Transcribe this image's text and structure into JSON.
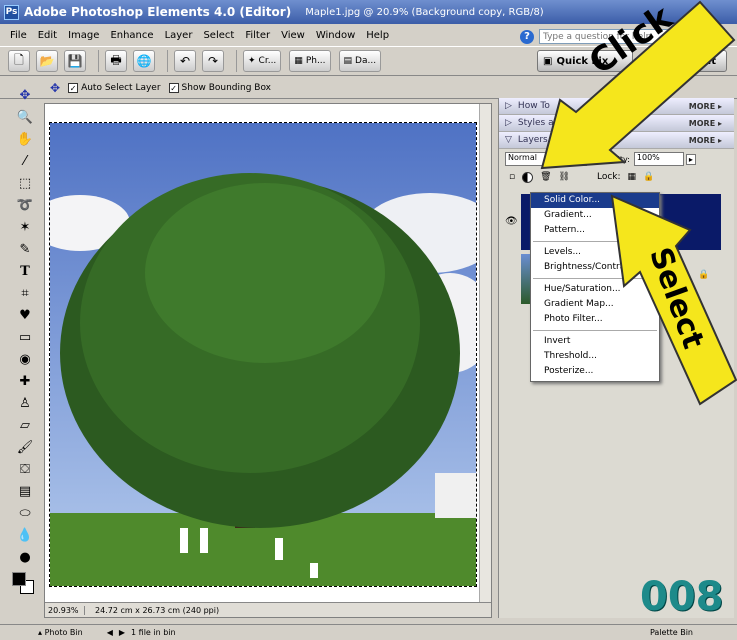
{
  "window": {
    "title": "Adobe Photoshop Elements 4.0 (Editor)",
    "document": "Maple1.jpg @ 20.9% (Background copy, RGB/8)"
  },
  "menu": [
    "File",
    "Edit",
    "Image",
    "Enhance",
    "Layer",
    "Select",
    "Filter",
    "View",
    "Window",
    "Help"
  ],
  "help": {
    "placeholder": "Type a question for help"
  },
  "shortcuts": {
    "create_label": "Cr...",
    "photo_label": "Ph...",
    "date_label": "Da..."
  },
  "modes": {
    "quick_fix": "Quick Fix",
    "edit": "Edit"
  },
  "options": {
    "auto_select": "Auto Select Layer",
    "bounding_box": "Show Bounding Box"
  },
  "canvas": {
    "zoom": "20.93%",
    "size": "24.72 cm x 26.73 cm (240 ppi)"
  },
  "palette": {
    "how_to": "How To",
    "styles": "Styles and Effects",
    "layers": "Layers",
    "more": "MORE",
    "blend_mode": "Normal",
    "opacity_label": "Opacity:",
    "opacity_value": "100%",
    "lock_label": "Lock:"
  },
  "adjust_menu": {
    "group1": [
      "Solid Color...",
      "Gradient...",
      "Pattern..."
    ],
    "group2": [
      "Levels...",
      "Brightness/Contrast..."
    ],
    "group3": [
      "Hue/Saturation...",
      "Gradient Map...",
      "Photo Filter..."
    ],
    "group4": [
      "Invert",
      "Threshold...",
      "Posterize..."
    ],
    "selected": "Solid Color..."
  },
  "annotations": {
    "click": "Click",
    "select": "Select",
    "counter": "008"
  },
  "status": {
    "photo_bin": "Photo Bin",
    "files": "1 file in bin",
    "palette_bin": "Palette Bin"
  },
  "colors": {
    "arrow": "#f5e61c",
    "menu_highlight": "#1a3b8c",
    "counter": "#1d8a8a"
  }
}
